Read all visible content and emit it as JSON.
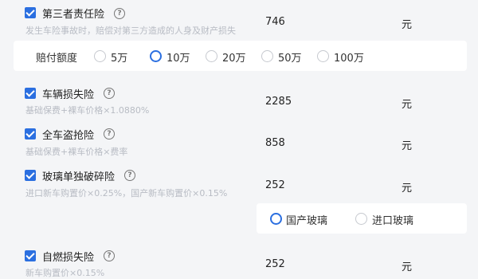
{
  "items": [
    {
      "title": "第三者责任险",
      "desc": "发生车险事故时，赔偿对第三方造成的人身及财产损失",
      "price": "746",
      "unit": "元",
      "checked": true
    },
    {
      "title": "车辆损失险",
      "desc": "基础保费+裸车价格×1.0880%",
      "price": "2285",
      "unit": "元",
      "checked": true
    },
    {
      "title": "全车盗抢险",
      "desc": "基础保费+裸车价格×费率",
      "price": "858",
      "unit": "元",
      "checked": true
    },
    {
      "title": "玻璃单独破碎险",
      "desc": "进口新车购置价×0.25%，国产新车购置价×0.15%",
      "price": "252",
      "unit": "元",
      "checked": true
    },
    {
      "title": "自燃损失险",
      "desc": "新车购置价×0.15%",
      "price": "252",
      "unit": "元",
      "checked": true
    }
  ],
  "help_glyph": "?",
  "coverage": {
    "label": "赔付额度",
    "options": [
      "5万",
      "10万",
      "20万",
      "50万",
      "100万"
    ],
    "selected": "10万"
  },
  "glass": {
    "options": [
      "国产玻璃",
      "进口玻璃"
    ],
    "selected": "国产玻璃"
  },
  "colors": {
    "accent": "#2b6fe0",
    "desc": "#b8bcc4",
    "background": "#f4f5f7"
  }
}
